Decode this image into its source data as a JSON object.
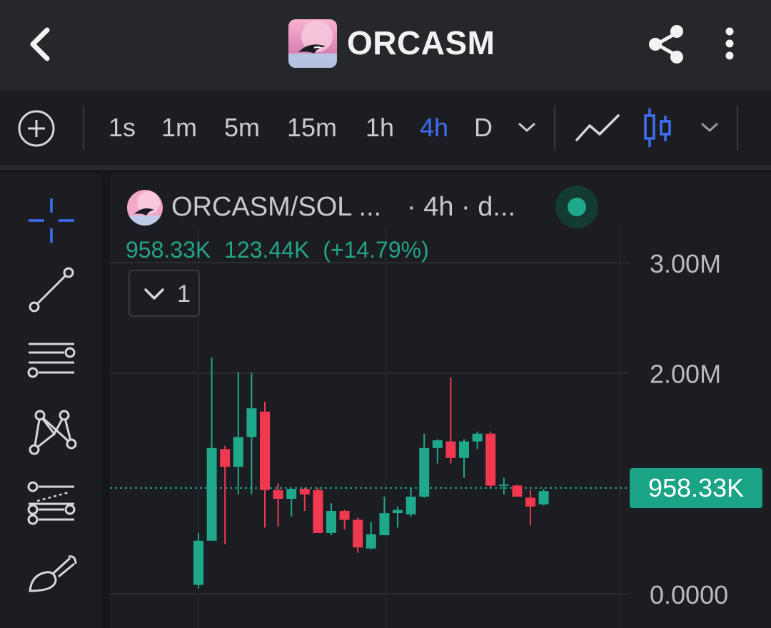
{
  "header": {
    "title": "ORCASM",
    "back_icon": "chevron-left-icon",
    "share_icon": "share-icon",
    "more_icon": "more-vertical-icon"
  },
  "toolbar": {
    "timeframes": [
      {
        "label": "1s",
        "active": false
      },
      {
        "label": "1m",
        "active": false
      },
      {
        "label": "5m",
        "active": false
      },
      {
        "label": "15m",
        "active": false
      },
      {
        "label": "1h",
        "active": false
      },
      {
        "label": "4h",
        "active": true
      },
      {
        "label": "D",
        "active": false
      }
    ],
    "chart_types": [
      "line-chart-icon",
      "candlestick-icon"
    ]
  },
  "drawing_tools": [
    "crosshair-icon",
    "trendline-icon",
    "horizontal-lines-icon",
    "pattern-icon",
    "fib-icon",
    "brush-icon"
  ],
  "legend": {
    "symbol": "ORCASM/SOL ...",
    "interval": "· 4h · d...",
    "value_1": "958.33K",
    "value_2": "123.44K",
    "change": "(+14.79%)",
    "indicators_count": "1"
  },
  "current_price": "958.33K",
  "colors": {
    "up": "#1fa88a",
    "down": "#f0394f",
    "accent": "#3d6ff2",
    "background": "#1c1d22"
  },
  "chart_data": {
    "type": "candlestick",
    "interval": "4h",
    "y_axis_labels": [
      "3.00M",
      "2.00M",
      "0.0000"
    ],
    "ylim": [
      0,
      3000000
    ],
    "last_price": 958330,
    "candles": [
      {
        "o": 80000,
        "h": 550000,
        "l": 50000,
        "c": 480000
      },
      {
        "o": 480000,
        "h": 2140000,
        "l": 480000,
        "c": 1320000
      },
      {
        "o": 1310000,
        "h": 1340000,
        "l": 450000,
        "c": 1150000
      },
      {
        "o": 1150000,
        "h": 2010000,
        "l": 900000,
        "c": 1420000
      },
      {
        "o": 1420000,
        "h": 2000000,
        "l": 900000,
        "c": 1680000
      },
      {
        "o": 1650000,
        "h": 1740000,
        "l": 600000,
        "c": 940000
      },
      {
        "o": 940000,
        "h": 1000000,
        "l": 610000,
        "c": 860000
      },
      {
        "o": 860000,
        "h": 960000,
        "l": 700000,
        "c": 950000
      },
      {
        "o": 950000,
        "h": 960000,
        "l": 750000,
        "c": 900000
      },
      {
        "o": 940000,
        "h": 960000,
        "l": 550000,
        "c": 550000
      },
      {
        "o": 550000,
        "h": 820000,
        "l": 530000,
        "c": 750000
      },
      {
        "o": 750000,
        "h": 760000,
        "l": 580000,
        "c": 670000
      },
      {
        "o": 670000,
        "h": 690000,
        "l": 370000,
        "c": 420000
      },
      {
        "o": 410000,
        "h": 650000,
        "l": 400000,
        "c": 540000
      },
      {
        "o": 530000,
        "h": 880000,
        "l": 540000,
        "c": 730000
      },
      {
        "o": 730000,
        "h": 790000,
        "l": 600000,
        "c": 760000
      },
      {
        "o": 720000,
        "h": 960000,
        "l": 700000,
        "c": 880000
      },
      {
        "o": 880000,
        "h": 1450000,
        "l": 870000,
        "c": 1320000
      },
      {
        "o": 1320000,
        "h": 1400000,
        "l": 1180000,
        "c": 1390000
      },
      {
        "o": 1380000,
        "h": 1960000,
        "l": 1180000,
        "c": 1230000
      },
      {
        "o": 1230000,
        "h": 1400000,
        "l": 1050000,
        "c": 1380000
      },
      {
        "o": 1380000,
        "h": 1470000,
        "l": 1310000,
        "c": 1450000
      },
      {
        "o": 1450000,
        "h": 1470000,
        "l": 960000,
        "c": 980000
      },
      {
        "o": 990000,
        "h": 1050000,
        "l": 900000,
        "c": 990000
      },
      {
        "o": 980000,
        "h": 990000,
        "l": 880000,
        "c": 880000
      },
      {
        "o": 870000,
        "h": 940000,
        "l": 620000,
        "c": 790000
      },
      {
        "o": 810000,
        "h": 950000,
        "l": 800000,
        "c": 930000
      }
    ]
  }
}
